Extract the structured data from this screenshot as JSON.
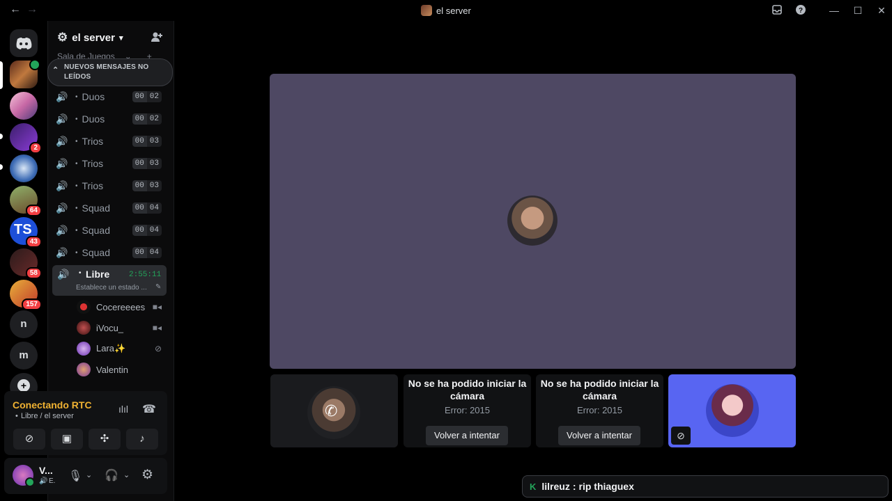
{
  "window": {
    "title": "el server",
    "back_icon": "arrow-left-icon",
    "forward_icon": "arrow-right-icon",
    "inbox_icon": "inbox-icon",
    "help_icon": "help-icon",
    "minimize_icon": "minimize-icon",
    "maximize_icon": "maximize-icon",
    "close_icon": "close-icon"
  },
  "rail": {
    "badges": [
      "2",
      "64",
      "43",
      "58",
      "157"
    ],
    "letters": [
      "n",
      "m"
    ]
  },
  "server": {
    "name": "el server",
    "category_partial": "Sala de Juegos",
    "unread_banner": "NUEVOS MENSAJES NO LEÍDOS"
  },
  "voice_channels": [
    {
      "name": "Duos",
      "count": "00",
      "limit": "02"
    },
    {
      "name": "Duos",
      "count": "00",
      "limit": "02"
    },
    {
      "name": "Trios",
      "count": "00",
      "limit": "03"
    },
    {
      "name": "Trios",
      "count": "00",
      "limit": "03"
    },
    {
      "name": "Trios",
      "count": "00",
      "limit": "03"
    },
    {
      "name": "Squad",
      "count": "00",
      "limit": "04"
    },
    {
      "name": "Squad",
      "count": "00",
      "limit": "04"
    },
    {
      "name": "Squad",
      "count": "00",
      "limit": "04"
    }
  ],
  "active_channel": {
    "name": "Libre",
    "timer": "2:55:11",
    "status_placeholder": "Establece un estado ..."
  },
  "members": [
    {
      "name": "Cocereeees"
    },
    {
      "name": "iVocu_"
    },
    {
      "name": "Lara✨"
    },
    {
      "name": "Valentin"
    }
  ],
  "voice_status": {
    "state": "Conectando RTC",
    "location": "Libre / el server"
  },
  "user": {
    "name": "V...",
    "status": "E."
  },
  "tiles": [
    {
      "title": "No se ha podido iniciar la cámara",
      "error": "Error: 2015",
      "button": "Volver a intentar"
    },
    {
      "title": "No se ha podido iniciar la cámara",
      "error": "Error: 2015",
      "button": "Volver a intentar"
    }
  ],
  "chat_toast": {
    "user": "lilreuz",
    "separator": ":",
    "message": "rip thiaguex"
  },
  "colors": {
    "accent_green": "#23a55a",
    "warning_orange": "#f0b232",
    "stage_bg": "#4e4863",
    "highlight_tile": "#5865f2"
  }
}
